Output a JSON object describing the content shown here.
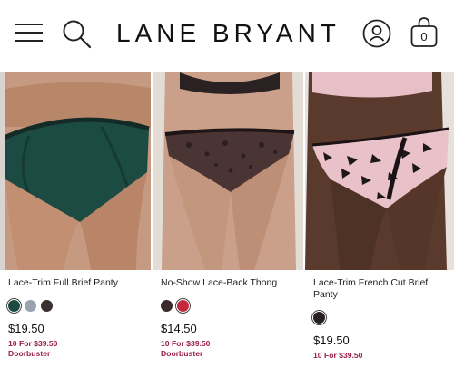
{
  "header": {
    "brand": "LANE BRYANT",
    "bag_count": "0"
  },
  "products": [
    {
      "title": "Lace-Trim Full Brief Panty",
      "price": "$19.50",
      "promo_deal": "10 For $39.50",
      "promo_tag": "Doorbuster",
      "swatches": [
        "#1c4a42",
        "#9aa3ad",
        "#3a3030"
      ]
    },
    {
      "title": "No-Show Lace-Back Thong",
      "price": "$14.50",
      "promo_deal": "10 For $39.50",
      "promo_tag": "Doorbuster",
      "swatches": [
        "#3b2a2a",
        "#c4283a"
      ]
    },
    {
      "title": "Lace-Trim French Cut Brief Panty",
      "price": "$19.50",
      "promo_deal": "10 For $39.50",
      "swatches": [
        "#2a1f24"
      ]
    }
  ]
}
